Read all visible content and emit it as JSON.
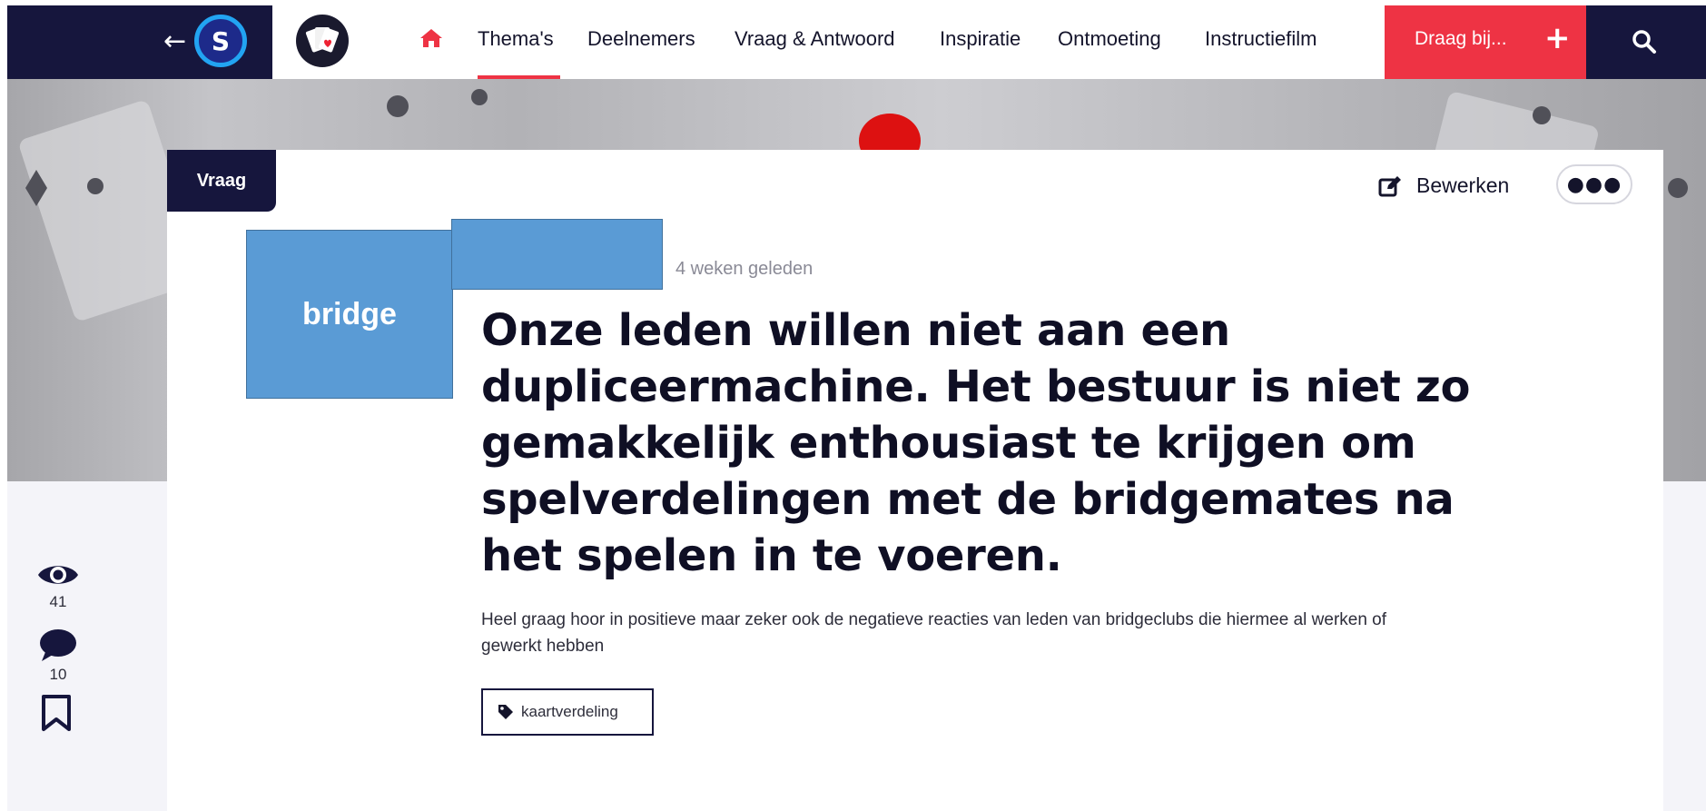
{
  "nav": {
    "back_icon": "arrow-left-icon",
    "brand_letter": "S",
    "links": [
      "Thema's",
      "Deelnemers",
      "Vraag & Antwoord",
      "Inspiratie",
      "Ontmoeting",
      "Instructiefilm"
    ],
    "active_link": "Thema's",
    "contribute_label": "Draag bij...",
    "contribute_icon": "plus-icon",
    "search_icon": "search-icon",
    "home_icon": "home-icon",
    "accent_color": "#ee3344",
    "dark_color": "#16163d"
  },
  "post": {
    "type_badge": "Vraag",
    "edit_label": "Bewerken",
    "more_icon": "more-icon",
    "time_ago": "4 weken geleden",
    "title": "Onze leden willen niet aan een dupliceermachine. Het bestuur is niet zo gemakkelijk enthousiast te krijgen om spelverdelingen met de bridgemates na het spelen in te voeren.",
    "description": "Heel graag hoor in positieve maar zeker ook de negatieve reacties van leden van bridgeclubs die hiermee al werken of gewerkt hebben",
    "tag": "kaartverdeling"
  },
  "overlay": {
    "label": "bridge"
  },
  "stats": {
    "views": "41",
    "comments": "10"
  }
}
